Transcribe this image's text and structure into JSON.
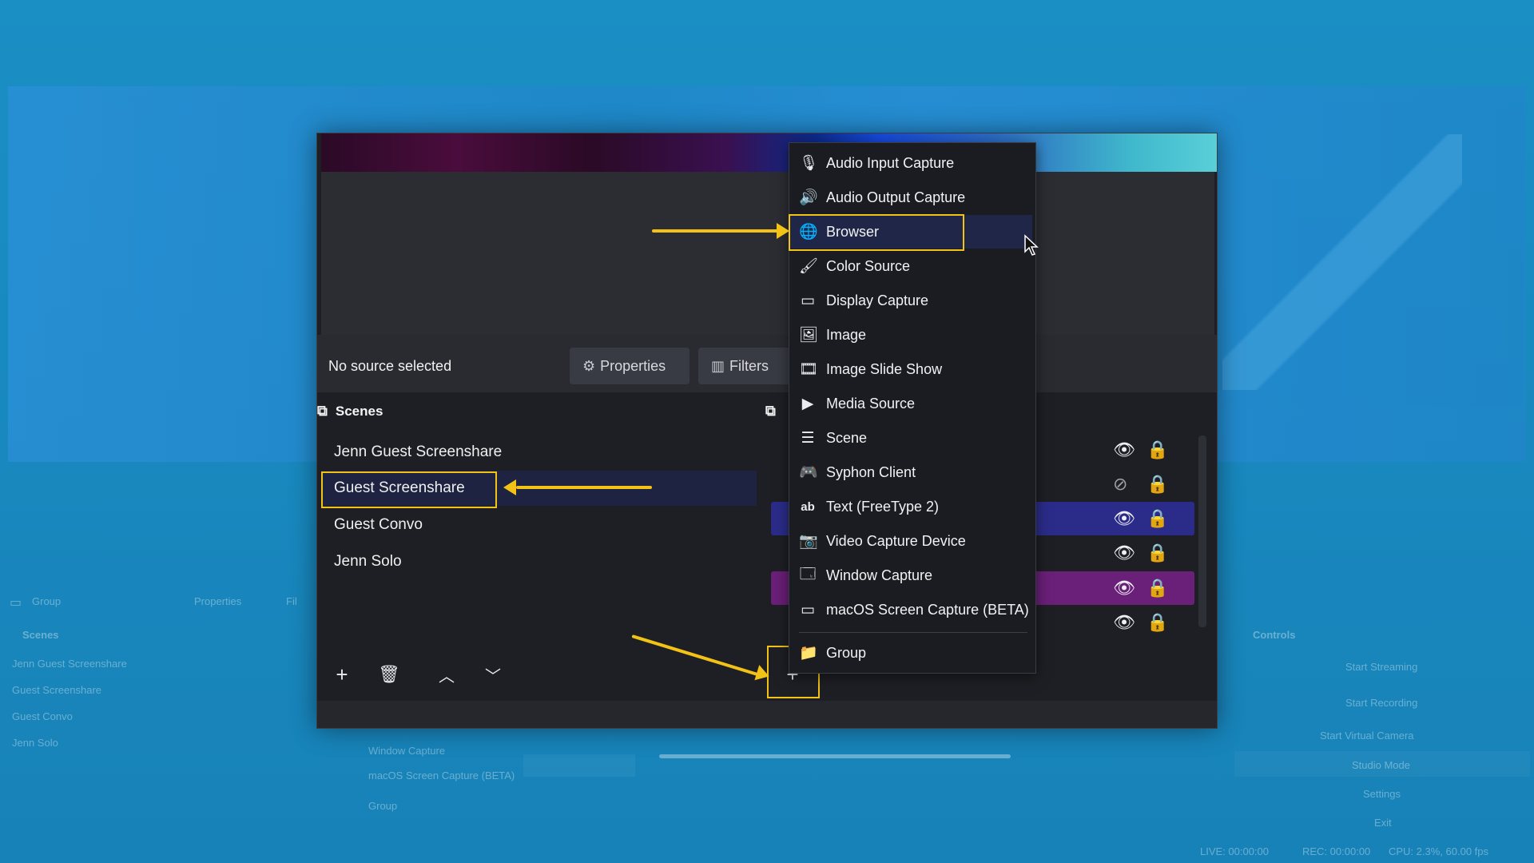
{
  "background_app": {
    "sources_dock_label": "Group",
    "properties_label": "Properties",
    "filters_label": "Fil",
    "scenes_title": "Scenes",
    "controls_title": "Controls",
    "scenes": [
      "Jenn Guest Screenshare",
      "Guest Screenshare",
      "Guest Convo",
      "Jenn Solo"
    ],
    "sources": [
      "Window Capture",
      "macOS Screen Capture (BETA)",
      "Group"
    ],
    "controls": [
      "Start Streaming",
      "Start Recording",
      "Start Virtual Camera",
      "Studio Mode",
      "Settings",
      "Exit"
    ],
    "status": {
      "live": "LIVE: 00:00:00",
      "rec": "REC: 00:00:00",
      "cpu": "CPU: 2.3%, 60.00 fps"
    }
  },
  "window": {
    "no_source_label": "No source selected",
    "properties_button": "Properties",
    "filters_button": "Filters",
    "scenes_dock_title": "Scenes",
    "scenes": [
      {
        "label": "Jenn Guest Screenshare",
        "selected": false
      },
      {
        "label": "Guest Screenshare",
        "selected": true
      },
      {
        "label": "Guest Convo",
        "selected": false
      },
      {
        "label": "Jenn Solo",
        "selected": false
      }
    ],
    "sources_visibility": [
      "visible",
      "hidden",
      "visible",
      "visible",
      "visible",
      "visible"
    ]
  },
  "context_menu": {
    "items": [
      {
        "label": "Audio Input Capture",
        "icon": "microphone-icon"
      },
      {
        "label": "Audio Output Capture",
        "icon": "speaker-icon"
      },
      {
        "label": "Browser",
        "icon": "globe-icon",
        "highlighted": true
      },
      {
        "label": "Color Source",
        "icon": "paintbrush-icon"
      },
      {
        "label": "Display Capture",
        "icon": "monitor-icon"
      },
      {
        "label": "Image",
        "icon": "image-icon"
      },
      {
        "label": "Image Slide Show",
        "icon": "slideshow-icon"
      },
      {
        "label": "Media Source",
        "icon": "play-icon"
      },
      {
        "label": "Scene",
        "icon": "list-icon"
      },
      {
        "label": "Syphon Client",
        "icon": "gamepad-icon"
      },
      {
        "label": "Text (FreeType 2)",
        "icon": "text-icon"
      },
      {
        "label": "Video Capture Device",
        "icon": "camera-icon"
      },
      {
        "label": "Window Capture",
        "icon": "window-icon"
      },
      {
        "label": "macOS Screen Capture (BETA)",
        "icon": "monitor-icon"
      },
      {
        "label": "Group",
        "icon": "folder-icon"
      }
    ]
  },
  "colors": {
    "annotation": "#f2c316",
    "menu_hover": "#1f2648",
    "background": "#1688bd",
    "source_row_blue": "#2b2c8a",
    "source_row_purple": "#6a1f78"
  }
}
